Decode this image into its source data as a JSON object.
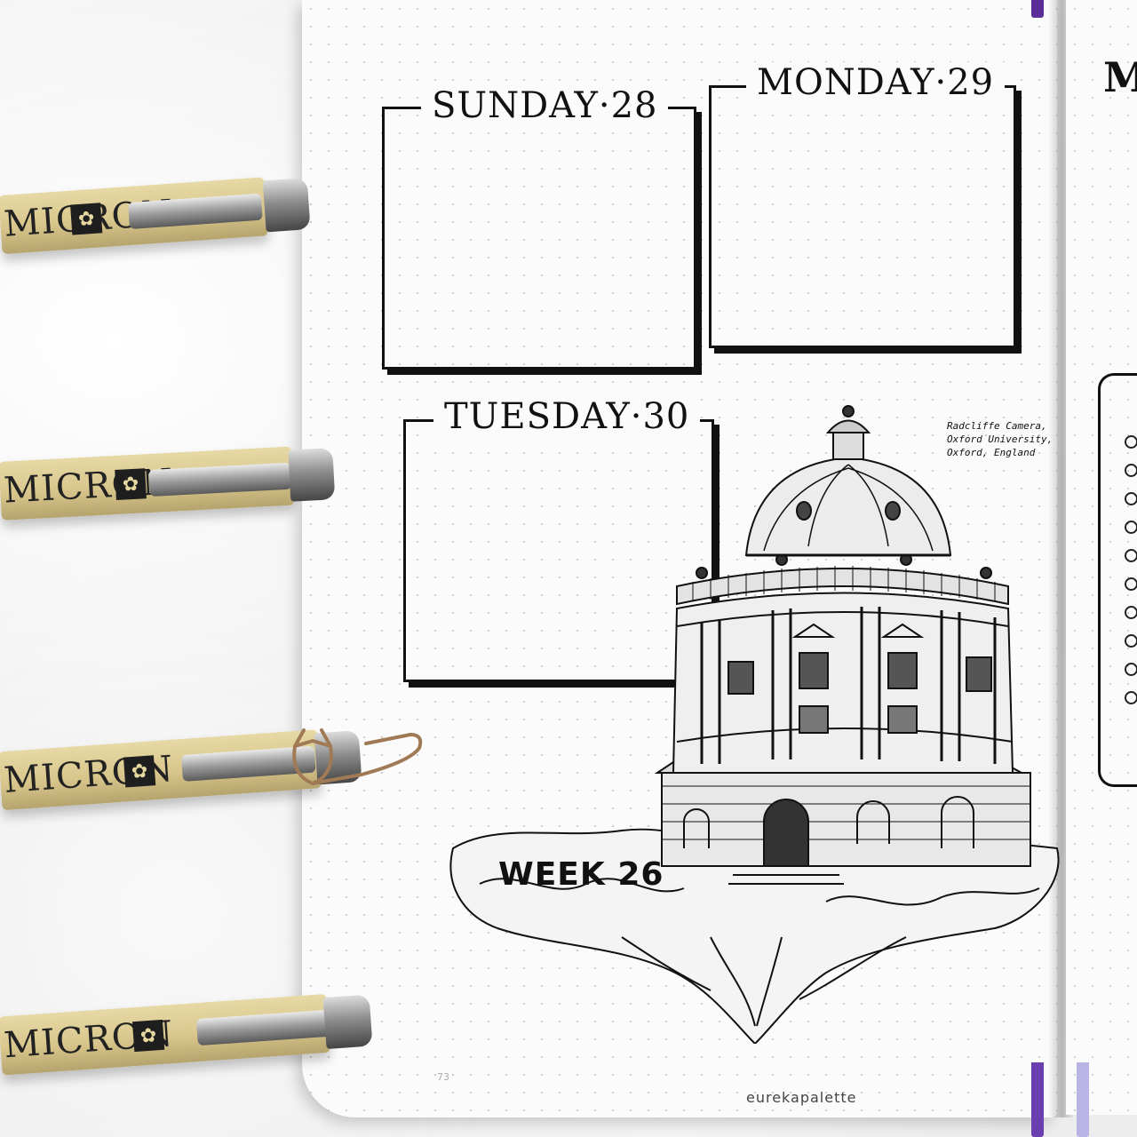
{
  "journal": {
    "days": [
      {
        "label": "SUNDAY·28"
      },
      {
        "label": "MONDAY·29"
      },
      {
        "label": "TUESDAY·30"
      }
    ],
    "caption_lines": [
      "Radcliffe Camera,",
      "Oxford University,",
      "Oxford, England"
    ],
    "week_label": "WEEK 26",
    "page_number": "73",
    "right_page_partial_letter": "M"
  },
  "pens": {
    "brand_text": "MICRON",
    "count": 4,
    "logo_icon": "sakura-flower-icon"
  },
  "watermark": "eurekapalette",
  "colors": {
    "ink": "#111111",
    "pen_barrel": "#d8c68c",
    "ribbon_purple": "#6b3fb0",
    "ribbon_lavender": "#b9b4e6",
    "paperclip": "#a07a55"
  }
}
